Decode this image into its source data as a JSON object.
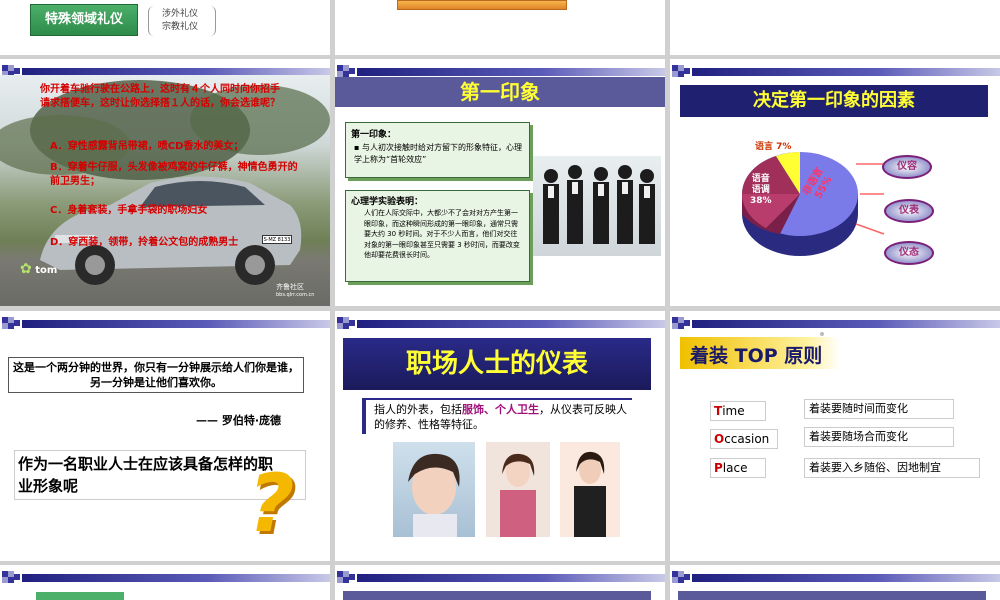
{
  "slide1": {
    "tag": "特殊领域礼仪",
    "items": [
      "涉外礼仪",
      "宗教礼仪"
    ]
  },
  "slide4": {
    "question": "你开着车驰行驶在公路上，这时有４个人同时向你招手请求搭便车，这时让你选择搭１人的话，你会选谁呢？",
    "options": [
      "A．穿性感露背吊带裙，喷CD香水的美女；",
      "B．穿着牛仔服，头发像被鸡窝的牛仔裤，神情色勇开的前卫男生；",
      "C．身着套装，手拿手袋的职场妇女",
      "D．穿西装，领带，拎着公文包的成熟男士"
    ],
    "logo": "tom",
    "plate": "S·MZ 8133",
    "watermark": "齐鲁社区",
    "watermark_sub": "bbs.qlrr.com.cn"
  },
  "slide5": {
    "title": "第一印象",
    "box1_title": "第一印象：",
    "box1_text": "与人初次接触时给对方留下的形象特征，心理学上称为“首轮效应”",
    "box2_title": "心理学实验表明：",
    "box2_text": "人们在人际交际中，大都少不了会对对方产生第一眼印象，而这种瞬间形成的第一眼印象，通常只需要大约 30 秒时间。对于不少人而言，他们对交往对象的第一眼印象甚至只需要 3 秒时间，而要改变他却要花费很长时间。"
  },
  "slide6": {
    "title": "决定第一印象的因素",
    "pie_labels": {
      "lang": "语言 7%",
      "voice": "语音\n语调\n38%",
      "look": "非语言\n55%"
    },
    "factors": [
      "仪容",
      "仪表",
      "仪态"
    ]
  },
  "slide7": {
    "quote": "这是一个两分钟的世界，你只有一分钟展示给人们你是谁，另一分钟是让他们喜欢你。",
    "author": "—— 罗伯特·庞德",
    "question": "作为一名职业人士在应该具备怎样的职业形象呢",
    "mark": "?"
  },
  "slide8": {
    "title": "职场人士的仪表",
    "desc_pre": "指人的外表，包括",
    "desc_hl": "服饰、个人卫生",
    "desc_post": "，从仪表可反映人的修养、性格等特征。"
  },
  "slide9": {
    "title": "着装 TOP 原则",
    "rows": [
      {
        "initial": "T",
        "rest": "ime",
        "desc": "着装要随时间而变化"
      },
      {
        "initial": "O",
        "rest": "ccasion",
        "desc": "着装要随场合而变化"
      },
      {
        "initial": "P",
        "rest": "lace",
        "desc": "着装要入乡随俗、因地制宜"
      }
    ]
  },
  "colors": {
    "accent": "#2b2b8c",
    "red": "#cc0000",
    "yellow": "#ffff00",
    "purple": "#7a1f7a"
  }
}
